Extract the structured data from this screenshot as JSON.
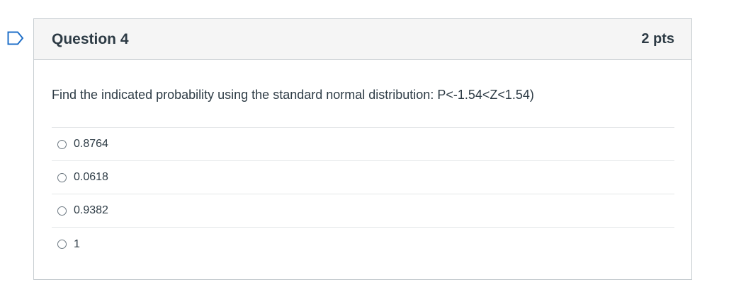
{
  "question": {
    "title": "Question 4",
    "points": "2 pts",
    "text": "Find the indicated probability using the standard normal distribution: P<-1.54<Z<1.54)",
    "answers": [
      {
        "label": "0.8764"
      },
      {
        "label": "0.0618"
      },
      {
        "label": "0.9382"
      },
      {
        "label": "1"
      }
    ]
  },
  "colors": {
    "flag_outline": "#1f6fc8",
    "border": "#c7cdd1",
    "header_bg": "#f5f5f5",
    "text": "#2d3b45"
  },
  "icons": {
    "flag": "bookmark-flag-icon"
  }
}
